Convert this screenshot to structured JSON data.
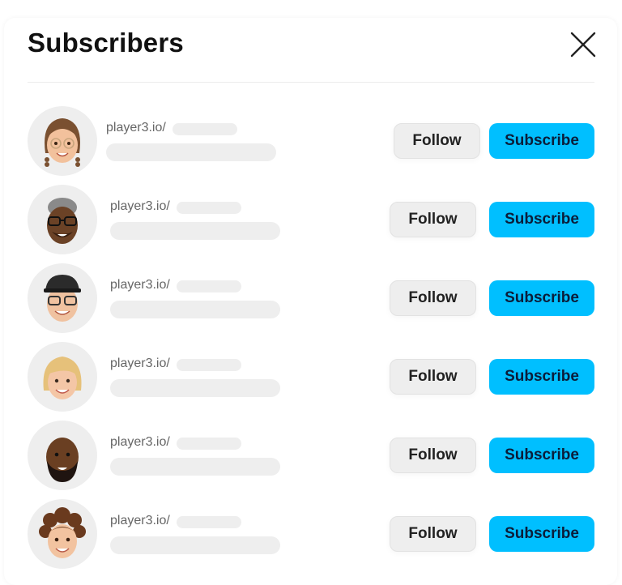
{
  "header": {
    "title": "Subscribers",
    "close_icon": "close-icon"
  },
  "subscribers": [
    {
      "avatar": "memoji-glasses-braids",
      "url_prefix": "player3.io/",
      "follow_label": "Follow",
      "subscribe_label": "Subscribe"
    },
    {
      "avatar": "memoji-grey-hair-glasses",
      "url_prefix": "player3.io/",
      "follow_label": "Follow",
      "subscribe_label": "Subscribe"
    },
    {
      "avatar": "memoji-cap-glasses",
      "url_prefix": "player3.io/",
      "follow_label": "Follow",
      "subscribe_label": "Subscribe"
    },
    {
      "avatar": "memoji-blonde-bob",
      "url_prefix": "player3.io/",
      "follow_label": "Follow",
      "subscribe_label": "Subscribe"
    },
    {
      "avatar": "memoji-bald-beard",
      "url_prefix": "player3.io/",
      "follow_label": "Follow",
      "subscribe_label": "Subscribe"
    },
    {
      "avatar": "memoji-curly-hair",
      "url_prefix": "player3.io/",
      "follow_label": "Follow",
      "subscribe_label": "Subscribe"
    }
  ],
  "colors": {
    "subscribe_button": "#00bfff",
    "follow_button": "#eeeeee",
    "placeholder": "#eeeeee"
  }
}
